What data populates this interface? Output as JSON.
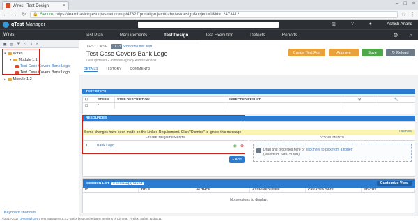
{
  "browser": {
    "tab_title": "Wires - Test Design",
    "secure_label": "Secure",
    "url": "https://learnbasictqtest.qtestnet.com/p/47327/portal/project#tab=testdesign&object=1&id=12473412"
  },
  "app": {
    "brand": "qTest",
    "brand_suffix": "Manager",
    "user": "Ashish Anand",
    "project": "Wires"
  },
  "nav": {
    "tabs": [
      "Test Plan",
      "Requirements",
      "Test Design",
      "Test Execution",
      "Defects",
      "Reports"
    ],
    "active": "Test Design"
  },
  "tree": {
    "root": "Wires",
    "module1": "Module 1.1",
    "item_selected": "Test Case Covers Bank Logo",
    "item2": "Test Case Covers Bank Logo",
    "module2": "Module 1.2",
    "keyboard_shortcuts": "Keyboard shortcuts"
  },
  "testcase": {
    "label": "TEST CASE",
    "id": "TC-3",
    "subscribe": "Subscribe this item",
    "title": "Test Case Covers Bank Logo",
    "updated": "Last updated 2 minutes ago by Ashish Anand"
  },
  "buttons": {
    "create_test_run": "Create Test Run",
    "approve": "Approve",
    "save": "Save",
    "reload": "Reload"
  },
  "subtabs": [
    "DETAILS",
    "HISTORY",
    "COMMENTS"
  ],
  "test_steps": {
    "header": "TEST STEPS",
    "columns": [
      "STEP #",
      "STEP DESCRIPTION",
      "EXPECTED RESULT"
    ],
    "row_marker": "*"
  },
  "resources": {
    "header": "RESOURCES",
    "banner": "Some changes have been made on the Linked Requirement. Click \"Dismiss\" to ignore this message",
    "dismiss": "Dismiss",
    "linked_header": "LINKED REQUIREMENTS",
    "attachments_header": "ATTACHMENTS",
    "rows": [
      {
        "index": "1",
        "name": "Bank Logo"
      }
    ],
    "add": "+ Add",
    "drop_text": "Drag and drop files here or",
    "drop_link": "click here to pick from a folder",
    "drop_max": "(Maximum Size: 50MB)"
  },
  "sessions": {
    "label": "SESSION LIST",
    "count": "0 session(s) found",
    "customize": "Customize View",
    "columns": [
      "ID",
      "TITLE",
      "AUTHOR",
      "ASSIGNED USER",
      "CREATED DATE",
      "STATUS"
    ],
    "empty": "No sessions to display."
  },
  "footer": {
    "copyright": "©2013-2017",
    "company": "QASymphony",
    "text": "qTest Manager 8.5.3.2 works best on the latest versions of Chrome, Firefox, Safari, and IE11."
  }
}
